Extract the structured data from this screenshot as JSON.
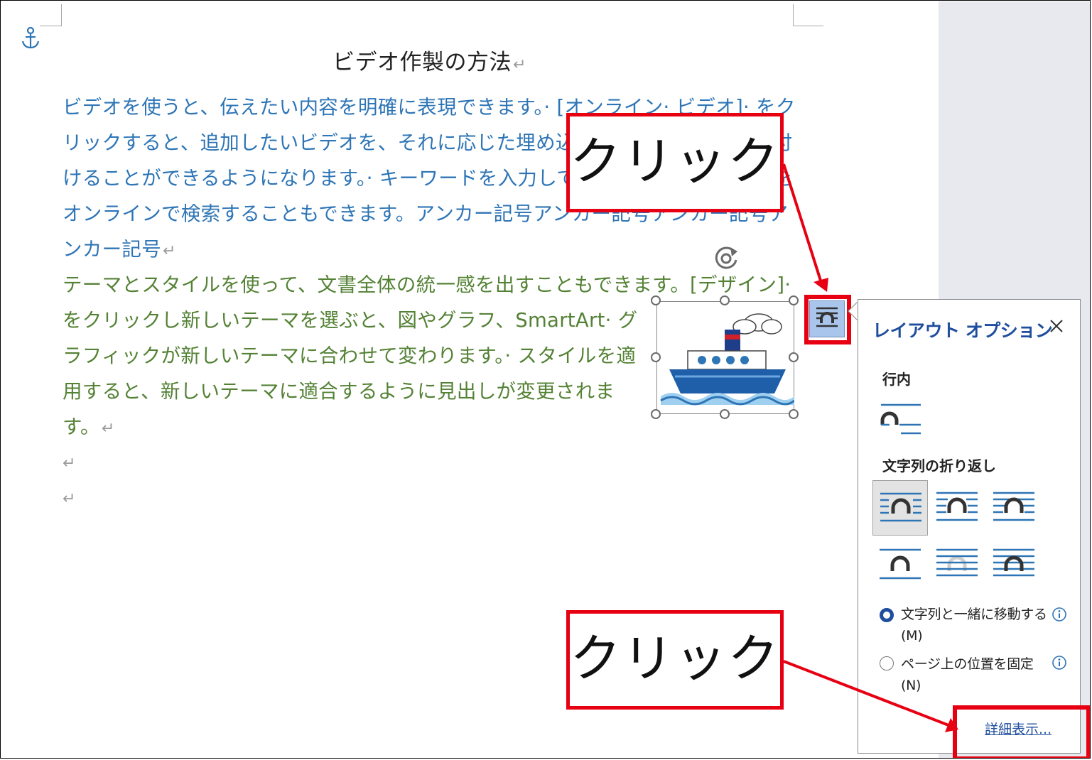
{
  "document": {
    "title": "ビデオ作製の方法",
    "return_mark": "↵",
    "paragraph1_lines": [
      "ビデオを使うと、伝えたい内容を明確に表現できます。· [オンライン· ビデオ]· をク",
      "リックすると、追加したいビデオを、それに応じた埋め込みコードの形式で貼り付",
      "けることができるようになります。· キーワードを入力して、文書に最適なビデオを",
      "オンラインで検索することもできます。アンカー記号アンカー記号アンカー記号ア",
      "ンカー記号"
    ],
    "paragraph2_lines": [
      "テーマとスタイルを使って、文書全体の統一感を出すこともできます。[デザイン]·",
      "をクリックし新しいテーマを選ぶと、図やグラフ、SmartArt· グ",
      "ラフィックが新しいテーマに合わせて変わります。· スタイルを適",
      "用すると、新しいテーマに適合するように見出しが変更されま",
      "す。"
    ]
  },
  "icons": {
    "anchor": "anchor-icon",
    "rotate": "rotate-handle-icon",
    "image": "ship-illustration",
    "layout_options_button": "layout-options-icon",
    "close": "close-icon",
    "info": "info-icon"
  },
  "layout_panel": {
    "title": "レイアウト オプション",
    "close_label": "✕",
    "inline_heading": "行内",
    "wrapping_heading": "文字列の折り返し",
    "radio_options": [
      {
        "label": "文字列と一緒に移動する(M)",
        "checked": true
      },
      {
        "label": "ページ上の位置を固定(N)",
        "checked": false
      }
    ],
    "more_link": "詳細表示..."
  },
  "callouts": {
    "top": "クリック",
    "bottom": "クリック"
  },
  "colors": {
    "highlight_red": "#e60012",
    "text_blue": "#2e75b6",
    "text_green": "#548235",
    "accent_navy": "#1f4e9e",
    "button_blue": "#a9c5ec"
  }
}
